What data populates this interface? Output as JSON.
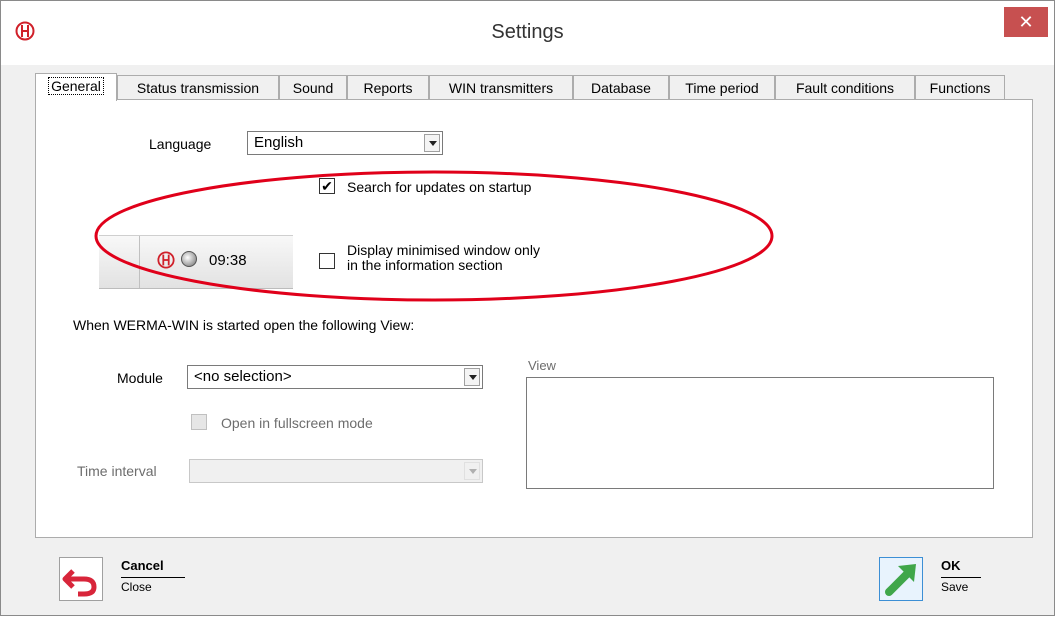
{
  "window": {
    "title": "Settings",
    "close_glyph": "✕"
  },
  "tabs": [
    {
      "label": "General",
      "active": true
    },
    {
      "label": "Status transmission"
    },
    {
      "label": "Sound"
    },
    {
      "label": "Reports"
    },
    {
      "label": "WIN transmitters"
    },
    {
      "label": "Database"
    },
    {
      "label": "Time period"
    },
    {
      "label": "Fault conditions"
    },
    {
      "label": "Functions"
    }
  ],
  "general": {
    "language_label": "Language",
    "language_value": "English",
    "search_updates_label": "Search for updates on startup",
    "search_updates_checked": true,
    "check_glyph": "✔",
    "display_minimised_line1": "Display minimised window only",
    "display_minimised_line2": "in the information section",
    "display_minimised_checked": false,
    "taskbar_time": "09:38",
    "startup_view_text": "When WERMA-WIN is started open the following View:",
    "module_label": "Module",
    "module_value": "<no selection>",
    "fullscreen_label": "Open in fullscreen mode",
    "time_interval_label": "Time interval",
    "time_interval_value": "",
    "view_label": "View"
  },
  "footer": {
    "cancel_title": "Cancel",
    "cancel_sub": "Close",
    "ok_title": "OK",
    "ok_sub": "Save"
  },
  "colors": {
    "highlight_ellipse": "#e0001a",
    "close_button": "#c75050",
    "brand_red": "#d0202a",
    "ok_green": "#3fa64a"
  }
}
